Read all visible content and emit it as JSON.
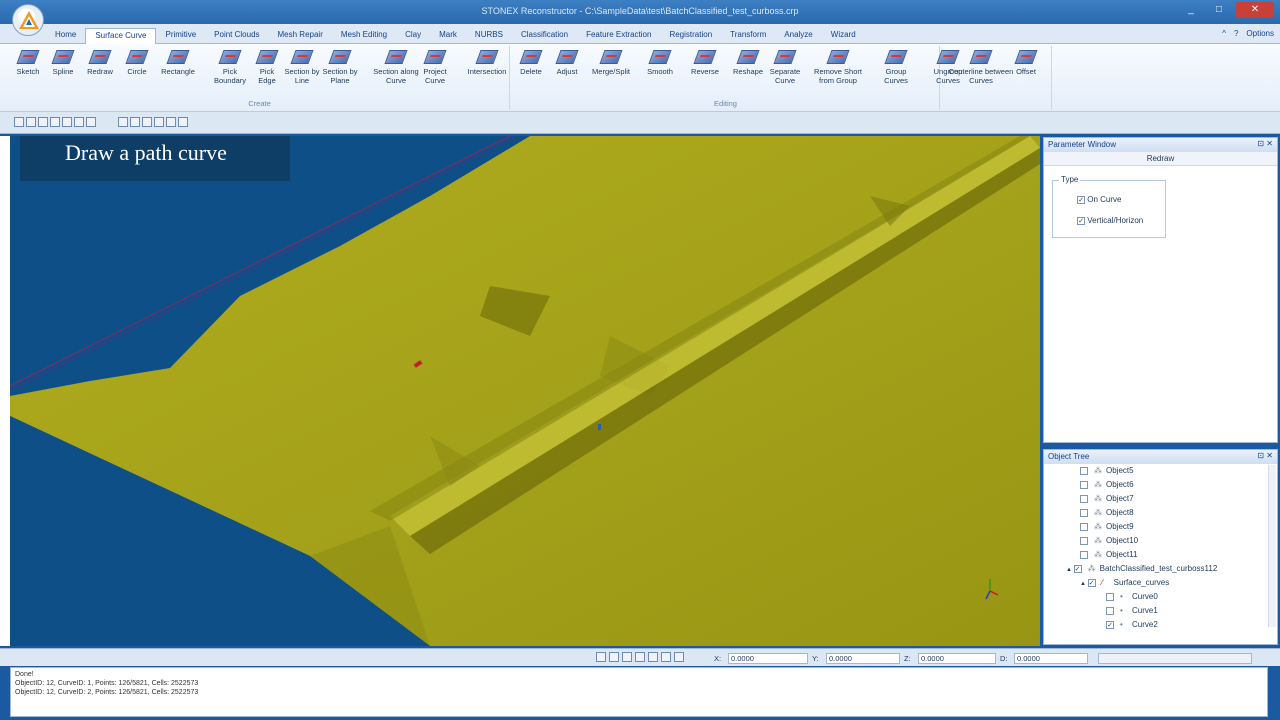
{
  "window": {
    "title": "STONEX Reconstructor - C:\\SampleData\\test\\BatchClassified_test_curboss.crp",
    "buttons": [
      "_",
      "□",
      "✕"
    ]
  },
  "ribbon": {
    "tabs": [
      "Home",
      "Surface Curve",
      "Primitive",
      "Point Clouds",
      "Mesh Repair",
      "Mesh Editing",
      "Clay",
      "Mark",
      "NURBS",
      "Classification",
      "Feature Extraction",
      "Registration",
      "Transform",
      "Analyze",
      "Wizard"
    ],
    "active_tab": "Surface Curve",
    "right": {
      "minimize": "^",
      "help": "?",
      "options": "Options"
    },
    "groups": [
      {
        "label": "Create",
        "buttons": [
          "Sketch",
          "Spline",
          "Redraw",
          "Circle",
          "Rectangle",
          "Pick Boundary",
          "Pick Edge",
          "Section by Line",
          "Section by Plane",
          "Section along Curve",
          "Project Curve",
          "Intersection"
        ]
      },
      {
        "label": "Editing",
        "buttons": [
          "Delete",
          "Adjust",
          "Merge/Split",
          "Smooth",
          "Reverse",
          "Reshape",
          "Separate Curve",
          "Remove Short from Group",
          "Group Curves",
          "Ungroup Curves"
        ]
      },
      {
        "label": "",
        "buttons": [
          "Centerline between Curves",
          "Offset"
        ]
      }
    ]
  },
  "viewport": {
    "caption": "Draw a path curve",
    "colors": {
      "water": "#0d4f86",
      "terrain": "#a6a418",
      "caption_bg": "#0e3d66"
    }
  },
  "parameter_window": {
    "title": "Parameter Window",
    "mode": "Redraw",
    "type_label": "Type",
    "options": [
      {
        "label": "On Curve",
        "checked": true
      },
      {
        "label": "Vertical/Horizon",
        "checked": true
      }
    ]
  },
  "object_tree": {
    "title": "Object Tree",
    "items": [
      {
        "label": "Object5",
        "checked": false
      },
      {
        "label": "Object6",
        "checked": false
      },
      {
        "label": "Object7",
        "checked": false
      },
      {
        "label": "Object8",
        "checked": false
      },
      {
        "label": "Object9",
        "checked": false
      },
      {
        "label": "Object10",
        "checked": false
      },
      {
        "label": "Object11",
        "checked": false
      },
      {
        "label": "BatchClassified_test_curboss112",
        "checked": true
      },
      {
        "label": "Surface_curves",
        "checked": true
      },
      {
        "label": "Curve0",
        "checked": false
      },
      {
        "label": "Curve1",
        "checked": false
      },
      {
        "label": "Curve2",
        "checked": true
      }
    ]
  },
  "coords": {
    "x_label": "X:",
    "x": "0.0000",
    "y_label": "Y:",
    "y": "0.0000",
    "z_label": "Z:",
    "z": "0.0000",
    "d_label": "D:",
    "d": "0.0000"
  },
  "console": {
    "lines": [
      "Done!",
      "ObjectID: 12, CurveID: 1, Points: 126/5821, Cells: 2522573",
      "ObjectID: 12, CurveID: 2, Points: 126/5821, Cells: 2522573"
    ]
  }
}
